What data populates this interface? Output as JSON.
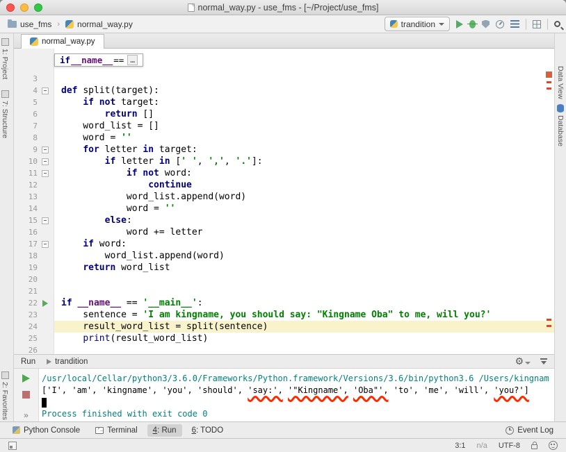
{
  "window": {
    "title": "normal_way.py - use_fms - [~/Project/use_fms]"
  },
  "navbar": {
    "crumbs": [
      {
        "label": "use_fms"
      },
      {
        "label": "normal_way.py"
      }
    ],
    "run_config": {
      "label": "trandition"
    }
  },
  "tab": {
    "label": "normal_way.py"
  },
  "tool_bars": {
    "left": [
      {
        "label": "1: Project"
      },
      {
        "label": "7: Structure"
      }
    ],
    "left_bottom": [
      {
        "label": "2: Favorites"
      }
    ],
    "right": [
      {
        "label": "Data View"
      },
      {
        "label": "Database"
      }
    ]
  },
  "editor": {
    "context": {
      "kw": "if ",
      "name": "__name__",
      "op": " == ",
      "ellipsis": "…"
    },
    "lines": [
      {
        "n": 3,
        "seg": []
      },
      {
        "n": 4,
        "fold": true,
        "seg": [
          [
            "k",
            "def "
          ],
          [
            "p",
            "split(target):"
          ]
        ]
      },
      {
        "n": 5,
        "seg": [
          [
            "p",
            "    "
          ],
          [
            "k",
            "if"
          ],
          [
            "p",
            " "
          ],
          [
            "k",
            "not"
          ],
          [
            "p",
            " target:"
          ]
        ]
      },
      {
        "n": 6,
        "seg": [
          [
            "p",
            "        "
          ],
          [
            "k",
            "return"
          ],
          [
            "p",
            " []"
          ]
        ]
      },
      {
        "n": 7,
        "seg": [
          [
            "p",
            "    word_list = []"
          ]
        ]
      },
      {
        "n": 8,
        "seg": [
          [
            "p",
            "    word = "
          ],
          [
            "s",
            "''"
          ]
        ]
      },
      {
        "n": 9,
        "fold": true,
        "seg": [
          [
            "p",
            "    "
          ],
          [
            "k",
            "for"
          ],
          [
            "p",
            " letter "
          ],
          [
            "k",
            "in"
          ],
          [
            "p",
            " target:"
          ]
        ]
      },
      {
        "n": 10,
        "fold": true,
        "seg": [
          [
            "p",
            "        "
          ],
          [
            "k",
            "if"
          ],
          [
            "p",
            " letter "
          ],
          [
            "k",
            "in"
          ],
          [
            "p",
            " ["
          ],
          [
            "s",
            "' '"
          ],
          [
            "p",
            ", "
          ],
          [
            "s",
            "','"
          ],
          [
            "p",
            ", "
          ],
          [
            "s",
            "'.'"
          ],
          [
            "p",
            "]:"
          ]
        ]
      },
      {
        "n": 11,
        "fold": true,
        "seg": [
          [
            "p",
            "            "
          ],
          [
            "k",
            "if"
          ],
          [
            "p",
            " "
          ],
          [
            "k",
            "not"
          ],
          [
            "p",
            " word:"
          ]
        ]
      },
      {
        "n": 12,
        "seg": [
          [
            "p",
            "                "
          ],
          [
            "k",
            "continue"
          ]
        ]
      },
      {
        "n": 13,
        "seg": [
          [
            "p",
            "            word_list.append(word)"
          ]
        ]
      },
      {
        "n": 14,
        "seg": [
          [
            "p",
            "            word = "
          ],
          [
            "s",
            "''"
          ]
        ]
      },
      {
        "n": 15,
        "fold": true,
        "seg": [
          [
            "p",
            "        "
          ],
          [
            "k",
            "else"
          ],
          [
            "p",
            ":"
          ]
        ]
      },
      {
        "n": 16,
        "seg": [
          [
            "p",
            "            word += letter"
          ]
        ]
      },
      {
        "n": 17,
        "fold": true,
        "seg": [
          [
            "p",
            "    "
          ],
          [
            "k",
            "if"
          ],
          [
            "p",
            " word:"
          ]
        ]
      },
      {
        "n": 18,
        "seg": [
          [
            "p",
            "        word_list.append(word)"
          ]
        ]
      },
      {
        "n": 19,
        "seg": [
          [
            "p",
            "    "
          ],
          [
            "k",
            "return"
          ],
          [
            "p",
            " word_list"
          ]
        ]
      },
      {
        "n": 20,
        "seg": []
      },
      {
        "n": 21,
        "seg": []
      },
      {
        "n": 22,
        "run": true,
        "seg": [
          [
            "k",
            "if"
          ],
          [
            "p",
            " "
          ],
          [
            "d",
            "__name__"
          ],
          [
            "p",
            " == "
          ],
          [
            "s",
            "'__main__'"
          ],
          [
            "p",
            ":"
          ]
        ]
      },
      {
        "n": 23,
        "seg": [
          [
            "p",
            "    sentence = "
          ],
          [
            "s",
            "'I am kingname, you should say: \"Kingname Oba\" to me, will you?'"
          ]
        ]
      },
      {
        "n": 24,
        "hl": true,
        "seg": [
          [
            "p",
            "    result_word_list = split(sentence)"
          ]
        ]
      },
      {
        "n": 25,
        "seg": [
          [
            "p",
            "    "
          ],
          [
            "b",
            "print"
          ],
          [
            "p",
            "(result_word_list)"
          ]
        ]
      },
      {
        "n": 26,
        "seg": []
      }
    ]
  },
  "run_panel": {
    "title": "Run",
    "config": "trandition",
    "console": {
      "lines": [
        {
          "type": "sys",
          "text": "/usr/local/Cellar/python3/3.6.0/Frameworks/Python.framework/Versions/3.6/bin/python3.6 /Users/kingnam"
        },
        {
          "type": "out",
          "segments": [
            {
              "t": "['I', 'am', 'kingname', 'you', 'should', "
            },
            {
              "t": "'say:',",
              "u": true
            },
            {
              "t": " "
            },
            {
              "t": "'\"Kingname',",
              "u": true
            },
            {
              "t": " "
            },
            {
              "t": "'Oba\"',",
              "u": true
            },
            {
              "t": " 'to', 'me', 'will', "
            },
            {
              "t": "'you?']",
              "u": true
            }
          ]
        },
        {
          "type": "caret"
        },
        {
          "type": "sys",
          "text": "Process finished with exit code 0"
        }
      ]
    }
  },
  "bottom_bar": {
    "left": [
      {
        "label": "Python Console",
        "icon": "py-s"
      },
      {
        "label": "Terminal",
        "icon": "term"
      },
      {
        "mnemonic": "4",
        "label": ": Run",
        "active": true
      },
      {
        "mnemonic": "6",
        "label": ": TODO"
      }
    ],
    "right": [
      {
        "label": "Event Log"
      }
    ]
  },
  "status_bar": {
    "caret_position": "3:1",
    "line_separator": "n/a",
    "encoding": "UTF-8"
  },
  "colors": {
    "keyword": "#000080",
    "string": "#008000",
    "annotation_red": "#ff2b00",
    "caret_row": "#f9f3cc",
    "run_green": "#59a869"
  }
}
